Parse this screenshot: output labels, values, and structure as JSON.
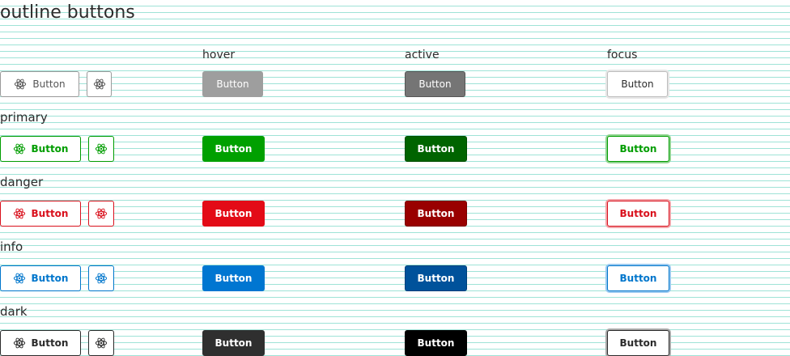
{
  "title": "outline buttons",
  "columns": [
    "hover",
    "active",
    "focus"
  ],
  "button_label": "Button",
  "icon_name": "atom-icon",
  "rows": [
    {
      "key": "default",
      "label": "",
      "color": "#555555",
      "border": "#9a9a9a",
      "hover_bg": "#9e9e9e",
      "hover_border": "#9e9e9e",
      "hover_text": "#ffffff",
      "active_bg": "#757575",
      "active_border": "#555555",
      "active_text": "#ffffff",
      "focus_border": "#bdbdbd",
      "focus_ring": "#e6e6e6",
      "focus_text": "#2b2b2b"
    },
    {
      "key": "primary",
      "label": "primary",
      "color": "#009d00",
      "border": "#009d00",
      "hover_bg": "#00a000",
      "hover_border": "#00a000",
      "hover_text": "#ffffff",
      "active_bg": "#006400",
      "active_border": "#004d00",
      "active_text": "#ffffff",
      "focus_border": "#009d00",
      "focus_ring": "#8fd48f",
      "focus_text": "#009d00"
    },
    {
      "key": "danger",
      "label": "danger",
      "color": "#d9101c",
      "border": "#d9101c",
      "hover_bg": "#e30b17",
      "hover_border": "#e30b17",
      "hover_text": "#ffffff",
      "active_bg": "#990000",
      "active_border": "#7a0000",
      "active_text": "#ffffff",
      "focus_border": "#d9101c",
      "focus_ring": "#f2a3a8",
      "focus_text": "#d9101c"
    },
    {
      "key": "info",
      "label": "info",
      "color": "#0076cc",
      "border": "#0076cc",
      "hover_bg": "#0076d1",
      "hover_border": "#0076d1",
      "hover_text": "#ffffff",
      "active_bg": "#00529b",
      "active_border": "#003f7a",
      "active_text": "#ffffff",
      "focus_border": "#0076cc",
      "focus_ring": "#99c9f0",
      "focus_text": "#0076cc"
    },
    {
      "key": "dark",
      "label": "dark",
      "color": "#2b2b2b",
      "border": "#2b2b2b",
      "hover_bg": "#2f2f2f",
      "hover_border": "#2f2f2f",
      "hover_text": "#ffffff",
      "active_bg": "#000000",
      "active_border": "#000000",
      "active_text": "#ffffff",
      "focus_border": "#2b2b2b",
      "focus_ring": "#a8a8a8",
      "focus_text": "#2b2b2b"
    }
  ]
}
